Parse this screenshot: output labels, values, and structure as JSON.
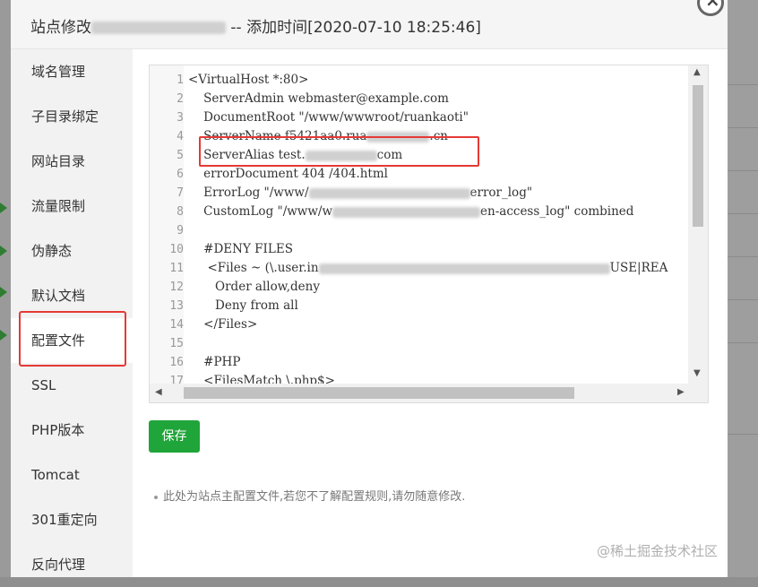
{
  "modal": {
    "title_prefix": "站点修改",
    "title_suffix": " -- 添加时间[2020-07-10 18:25:46]",
    "close_glyph": "×"
  },
  "sidebar": {
    "items": [
      {
        "label": "域名管理"
      },
      {
        "label": "子目录绑定"
      },
      {
        "label": "网站目录"
      },
      {
        "label": "流量限制"
      },
      {
        "label": "伪静态"
      },
      {
        "label": "默认文档"
      },
      {
        "label": "配置文件"
      },
      {
        "label": "SSL"
      },
      {
        "label": "PHP版本"
      },
      {
        "label": "Tomcat"
      },
      {
        "label": "301重定向"
      },
      {
        "label": "反向代理"
      }
    ],
    "active_index": 6
  },
  "editor": {
    "line_numbers": [
      "1",
      "2",
      "3",
      "4",
      "5",
      "6",
      "7",
      "8",
      "9",
      "10",
      "11",
      "12",
      "13",
      "14",
      "15",
      "16",
      "17"
    ],
    "lines": [
      "<VirtualHost *:80>",
      "    ServerAdmin webmaster@example.com",
      "    DocumentRoot \"/www/wwwroot/ruankaoti\"",
      "    ServerName f5421aa0.rua",
      "    ServerAlias test.",
      "    errorDocument 404 /404.html",
      "    ErrorLog \"/www/",
      "    CustomLog \"/www/w",
      "",
      "    #DENY FILES",
      "     <Files ~ (\\.user.in",
      "       Order allow,deny",
      "       Deny from all",
      "    </Files>",
      "",
      "    #PHP",
      "    <FilesMatch \\.php$>"
    ],
    "line_tails": {
      "4": ".cn",
      "5": "com",
      "7": "error_log\"",
      "8": "en-access_log\" combined",
      "11": "USE|REA"
    }
  },
  "actions": {
    "save_label": "保存"
  },
  "note": "此处为站点主配置文件,若您不了解配置规则,请勿随意修改.",
  "watermark": "@稀土掘金技术社区",
  "colors": {
    "save_button": "#20a53a",
    "highlight_border": "#e53935",
    "active_nav_bg": "#ffffff"
  }
}
